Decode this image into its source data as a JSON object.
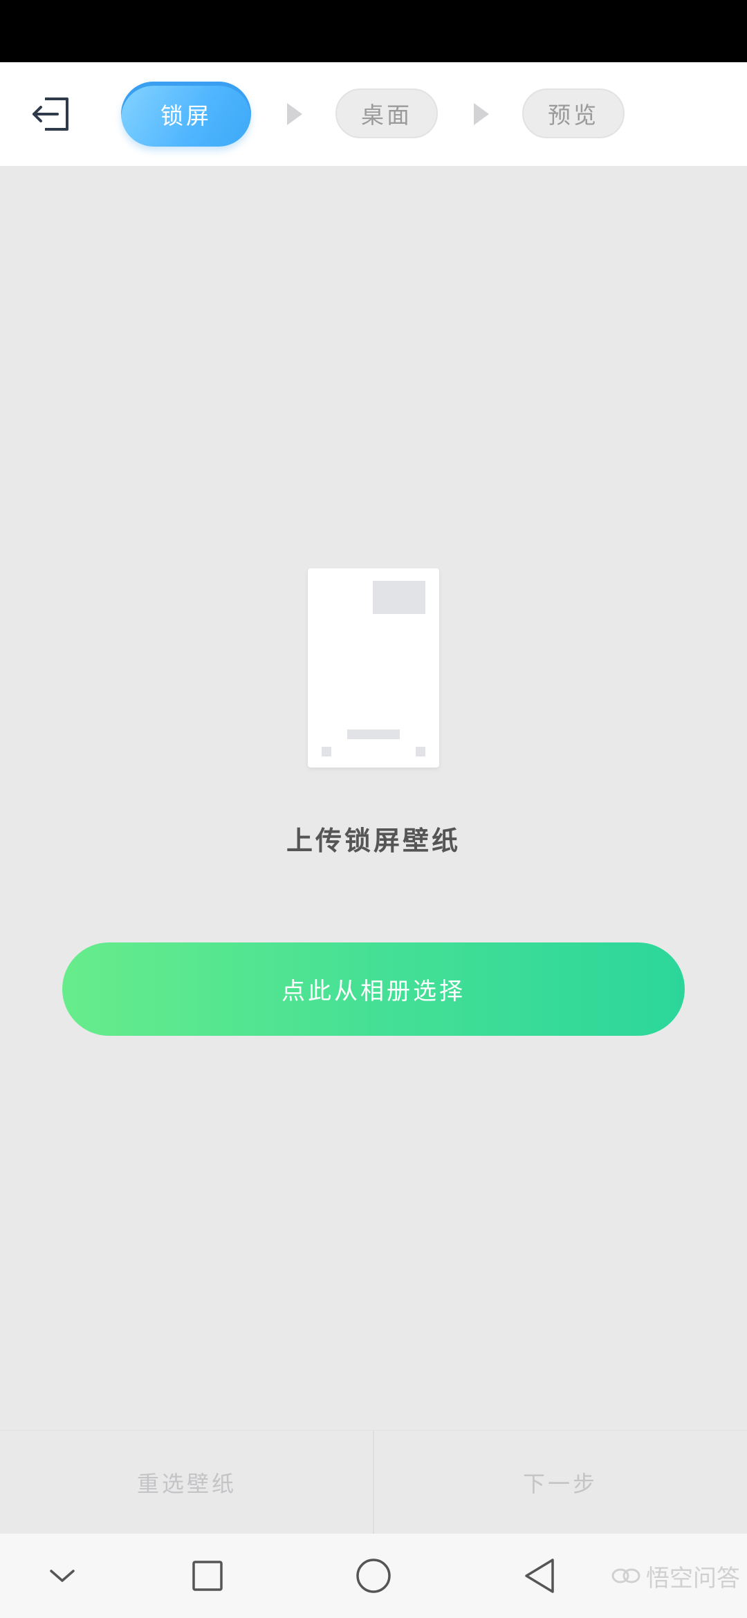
{
  "header": {
    "back_icon": "exit-icon",
    "steps": [
      {
        "label": "锁屏",
        "state": "active"
      },
      {
        "label": "桌面",
        "state": "inactive"
      },
      {
        "label": "预览",
        "state": "inactive"
      }
    ]
  },
  "main": {
    "upload_title": "上传锁屏壁纸",
    "pick_button_label": "点此从相册选择"
  },
  "action_bar": {
    "reselect_label": "重选壁纸",
    "next_label": "下一步"
  },
  "nav_bar": {
    "icons": [
      "chevron-down-icon",
      "square-icon",
      "circle-icon",
      "triangle-back-icon"
    ]
  },
  "watermark": {
    "text": "悟空问答"
  },
  "colors": {
    "active_step": "#4fb5ff",
    "primary_button_start": "#67ec8b",
    "primary_button_end": "#2cd69a",
    "background": "#e9e9ea"
  }
}
